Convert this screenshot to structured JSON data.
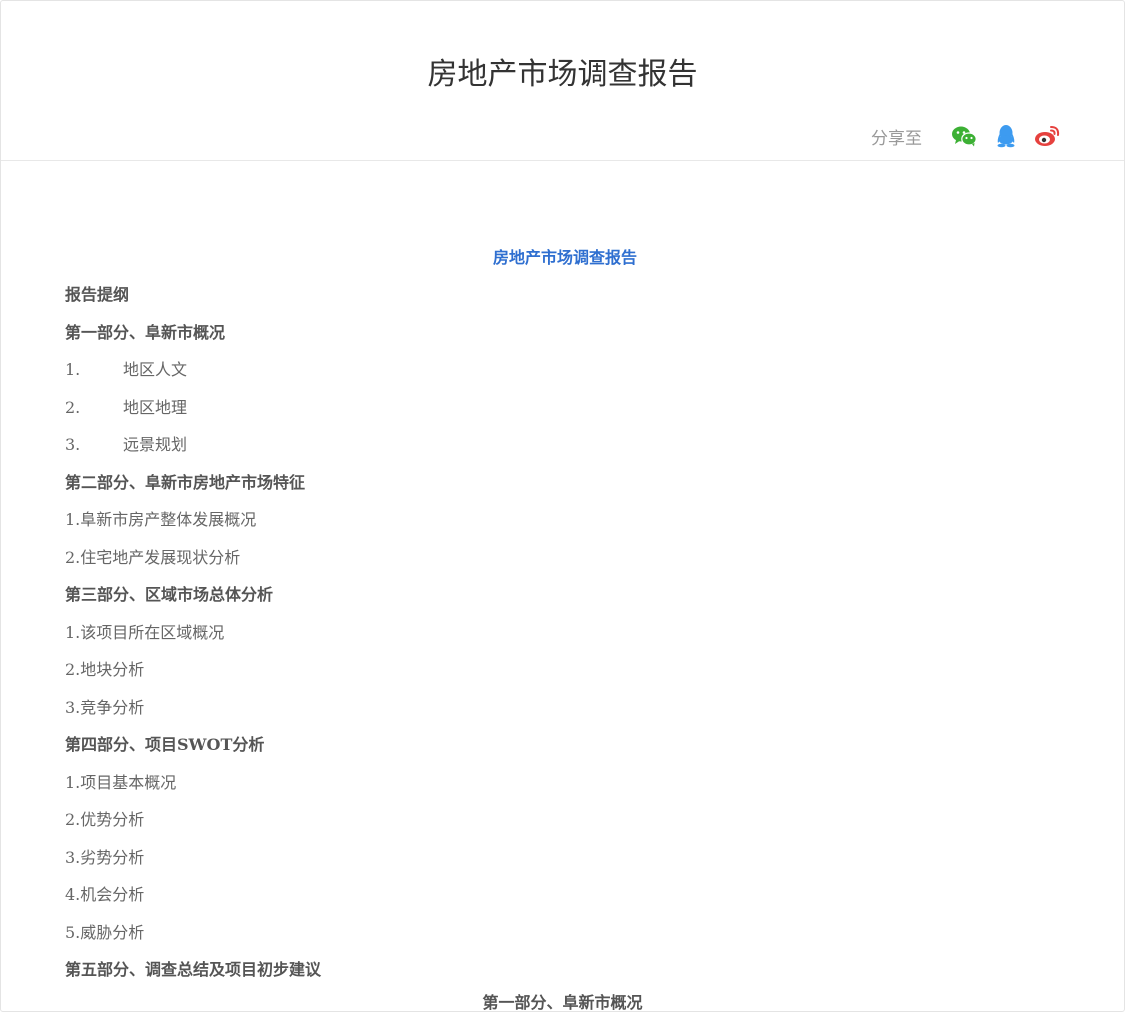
{
  "header": {
    "title": "房地产市场调查报告",
    "share_label": "分享至",
    "share_icons": [
      "wechat-icon",
      "qq-icon",
      "weibo-icon"
    ]
  },
  "document": {
    "title": "房地产市场调查报告",
    "lines": [
      {
        "text": "报告提纲",
        "bold": true
      },
      {
        "text": "第一部分、阜新市概况",
        "bold": true
      },
      {
        "num": "1.",
        "text": "地区人文",
        "bold": false
      },
      {
        "num": "2.",
        "text": "地区地理",
        "bold": false
      },
      {
        "num": "3.",
        "text": "远景规划",
        "bold": false
      },
      {
        "text": "第二部分、阜新市房地产市场特征",
        "bold": true
      },
      {
        "text": "1.阜新市房产整体发展概况",
        "bold": false
      },
      {
        "text": "2.住宅地产发展现状分析",
        "bold": false
      },
      {
        "text": "第三部分、区域市场总体分析",
        "bold": true
      },
      {
        "text": "1.该项目所在区域概况",
        "bold": false
      },
      {
        "text": "2.地块分析",
        "bold": false
      },
      {
        "text": "3.竞争分析",
        "bold": false
      },
      {
        "text": "第四部分、项目SWOT分析",
        "bold": true
      },
      {
        "text": "1.项目基本概况",
        "bold": false
      },
      {
        "text": "2.优势分析",
        "bold": false
      },
      {
        "text": "3.劣势分析",
        "bold": false
      },
      {
        "text": "4.机会分析",
        "bold": false
      },
      {
        "text": "5.威胁分析",
        "bold": false
      },
      {
        "text": "第五部分、调查总结及项目初步建议",
        "bold": true
      }
    ],
    "cut_off_heading": "第一部分、阜新市概况"
  },
  "colors": {
    "doc_title": "#2f6fd0",
    "wechat": "#3cb034",
    "qq": "#3d9bf0",
    "weibo": "#e6413e"
  }
}
